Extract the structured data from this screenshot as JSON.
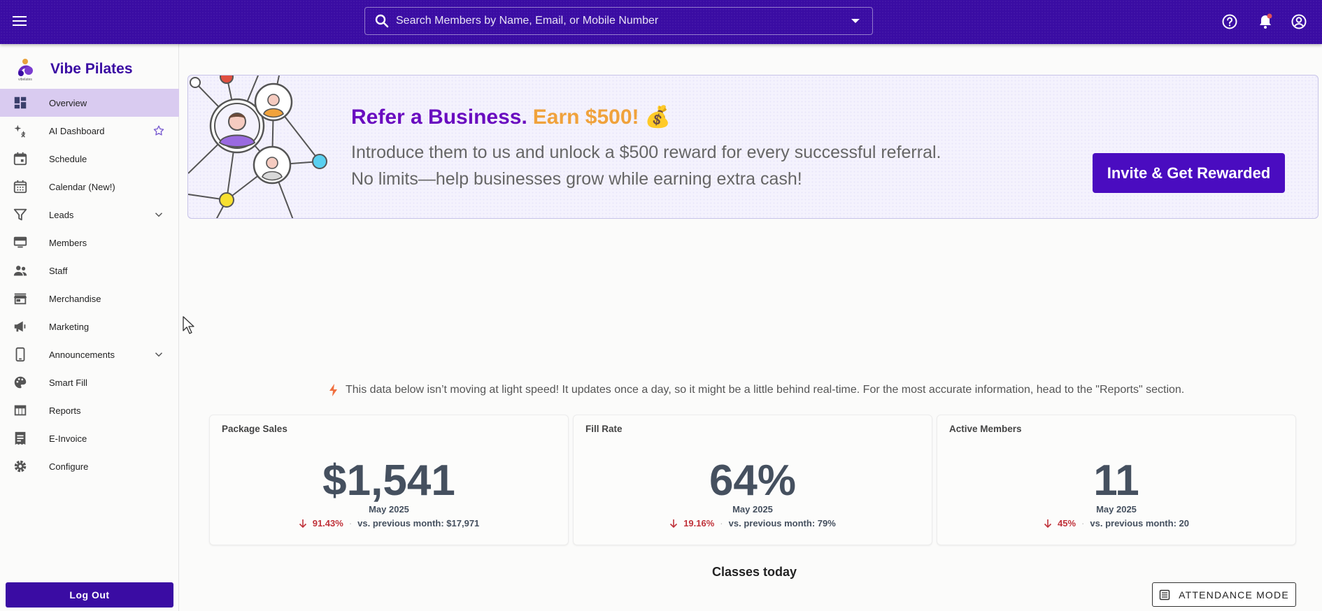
{
  "header": {
    "search_placeholder": "Search Members by Name, Email, or Mobile Number",
    "icons": [
      "menu-icon",
      "search-icon",
      "help-icon",
      "bell-icon",
      "account-icon"
    ]
  },
  "sidebar": {
    "brand_name": "Vibe Pilates",
    "brand_logo_text": "vibelates",
    "items": [
      {
        "label": "Overview",
        "icon": "dashboard-icon",
        "active": true
      },
      {
        "label": "AI Dashboard",
        "icon": "sparkle-icon",
        "extra": "star-icon"
      },
      {
        "label": "Schedule",
        "icon": "calendar-icon"
      },
      {
        "label": "Calendar (New!)",
        "icon": "calendar-grid-icon"
      },
      {
        "label": "Leads",
        "icon": "filter-icon",
        "extra": "chevron-down-icon"
      },
      {
        "label": "Members",
        "icon": "members-icon"
      },
      {
        "label": "Staff",
        "icon": "staff-icon"
      },
      {
        "label": "Merchandise",
        "icon": "store-icon"
      },
      {
        "label": "Marketing",
        "icon": "megaphone-icon"
      },
      {
        "label": "Announcements",
        "icon": "phone-icon",
        "extra": "chevron-down-icon"
      },
      {
        "label": "Smart Fill",
        "icon": "palette-icon"
      },
      {
        "label": "Reports",
        "icon": "table-icon"
      },
      {
        "label": "E-Invoice",
        "icon": "receipt-icon"
      },
      {
        "label": "Configure",
        "icon": "gear-icon"
      }
    ],
    "logout_label": "Log Out"
  },
  "banner": {
    "title": "Refer a Business.",
    "earn": "Earn $500! 💰",
    "line1": "Introduce them to us and unlock a $500 reward for every successful referral.",
    "line2": "No limits—help businesses grow while earning extra cash!",
    "button_label": "Invite & Get Rewarded",
    "colors": {
      "title": "#6a0cc0",
      "earn": "#f0a23c",
      "button": "#4a0cc0"
    }
  },
  "notice": "This data below isn’t moving at light speed! It updates once a day, so it might be a little behind real-time. For the most accurate information, head to the \"Reports\" section.",
  "cards": [
    {
      "title": "Package Sales",
      "value": "$1,541",
      "period": "May 2025",
      "change": "91.43%",
      "prev": "vs. previous month: $17,971"
    },
    {
      "title": "Fill Rate",
      "value": "64%",
      "period": "May 2025",
      "change": "19.16%",
      "prev": "vs. previous month: 79%"
    },
    {
      "title": "Active Members",
      "value": "11",
      "period": "May 2025",
      "change": "45%",
      "prev": "vs. previous month: 20"
    }
  ],
  "classes_title": "Classes today",
  "attendance_label": "ATTENDANCE MODE",
  "theme": {
    "primary": "#3a0ca3",
    "active_nav": "#d9cbf0",
    "negative": "#c0323a"
  }
}
